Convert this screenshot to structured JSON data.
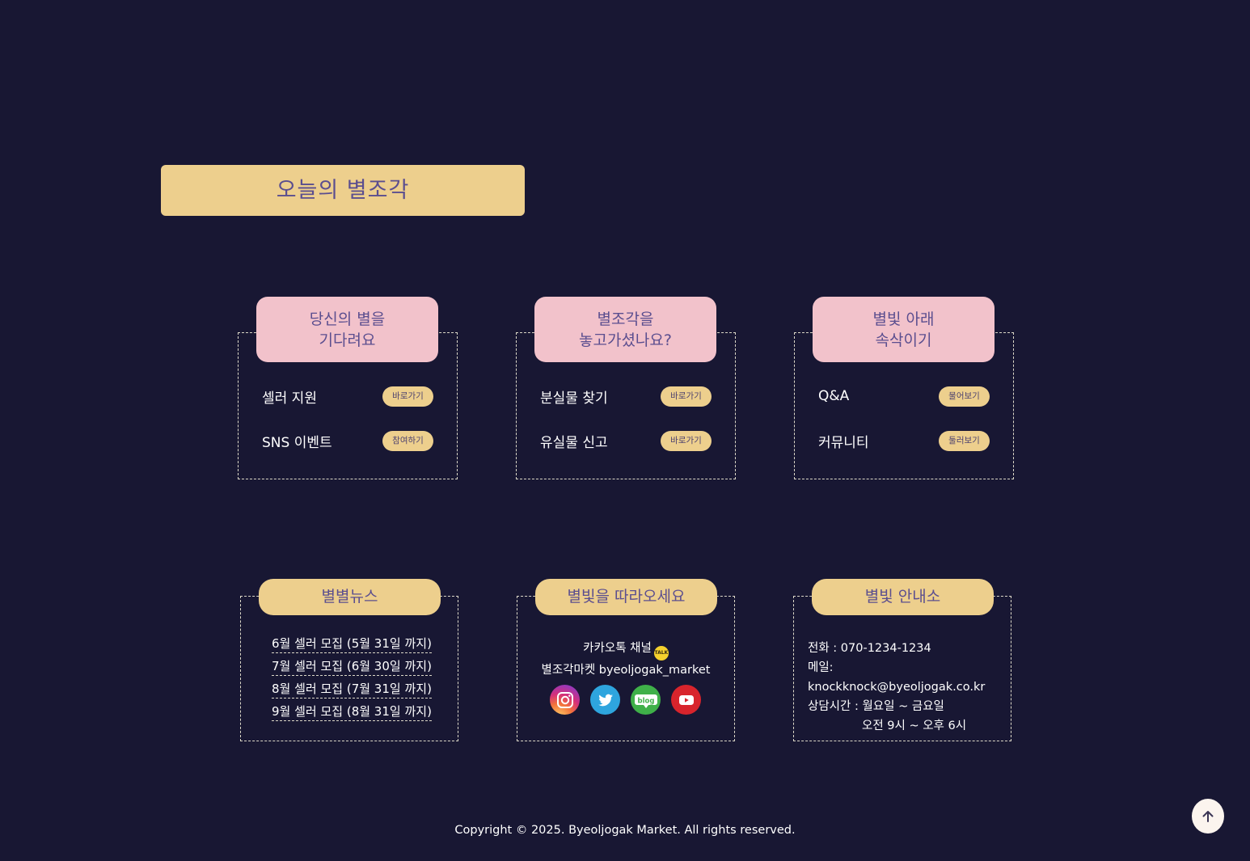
{
  "section_title": "오늘의 별조각",
  "top_cards": [
    {
      "title_line1": "당신의 별을",
      "title_line2": "기다려요",
      "rows": [
        {
          "label": "셀러 지원",
          "button": "바로가기"
        },
        {
          "label": "SNS 이벤트",
          "button": "참여하기"
        }
      ]
    },
    {
      "title_line1": "별조각을",
      "title_line2": "놓고가셨나요?",
      "rows": [
        {
          "label": "분실물 찾기",
          "button": "바로가기"
        },
        {
          "label": "유실물 신고",
          "button": "바로가기"
        }
      ]
    },
    {
      "title_line1": "별빛 아래",
      "title_line2": "속삭이기",
      "rows": [
        {
          "label": "Q&A",
          "button": "물어보기"
        },
        {
          "label": "커뮤니티",
          "button": "둘러보기"
        }
      ]
    }
  ],
  "news": {
    "title": "별별뉴스",
    "items": [
      "6월 셀러 모집 (5월 31일 까지)",
      "7월 셀러 모집 (6월 30일 까지)",
      "8월 셀러 모집 (7월 31일 까지)",
      "9월 셀러 모집 (8월 31일 까지)"
    ]
  },
  "follow": {
    "title": "별빛을 따라오세요",
    "kakao_label": "카카오톡 채널",
    "kakao_badge": "TALK",
    "account_line": "별조각마켓 byeoljogak_market",
    "blog_label": "blog",
    "socials": [
      "instagram-icon",
      "twitter-icon",
      "blog-icon",
      "youtube-icon"
    ]
  },
  "info": {
    "title": "별빛 안내소",
    "phone": "전화 : 070-1234-1234",
    "mail": "메일: knockknock@byeoljogak.co.kr",
    "hours_line1": "상담시간 : 월요일 ~ 금요일",
    "hours_line2": "오전 9시 ~ 오후 6시"
  },
  "footer": {
    "copyright": "Copyright © 2025. Byeoljogak Market. All rights reserved."
  },
  "colors": {
    "background": "#181733",
    "gold": "#edcf8d",
    "pink": "#f2c2cb",
    "purple_text": "#5b4e8f"
  }
}
